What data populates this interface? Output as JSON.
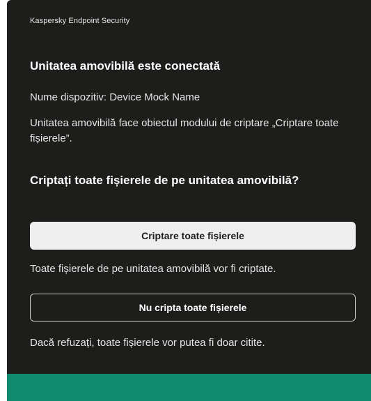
{
  "app": {
    "title": "Kaspersky Endpoint Security"
  },
  "notification": {
    "heading": "Unitatea amovibilă este conectată",
    "device_name": "Nume dispozitiv: Device Mock Name",
    "policy_text": "Unitatea amovibilă face obiectul modului de criptare „Criptare toate fișierele”.",
    "question": "Criptați toate fișierele de pe unitatea amovibilă?"
  },
  "actions": {
    "encrypt_label": "Criptare toate fișierele",
    "encrypt_hint": "Toate fișierele de pe unitatea amovibilă vor fi criptate.",
    "decline_label": "Nu cripta toate fișierele",
    "decline_hint": "Dacă refuzați, toate fișierele vor putea fi doar citite."
  },
  "colors": {
    "background": "#1d1d1b",
    "primary_button": "#eeeeee",
    "accent_bar": "#0f8a6e"
  }
}
